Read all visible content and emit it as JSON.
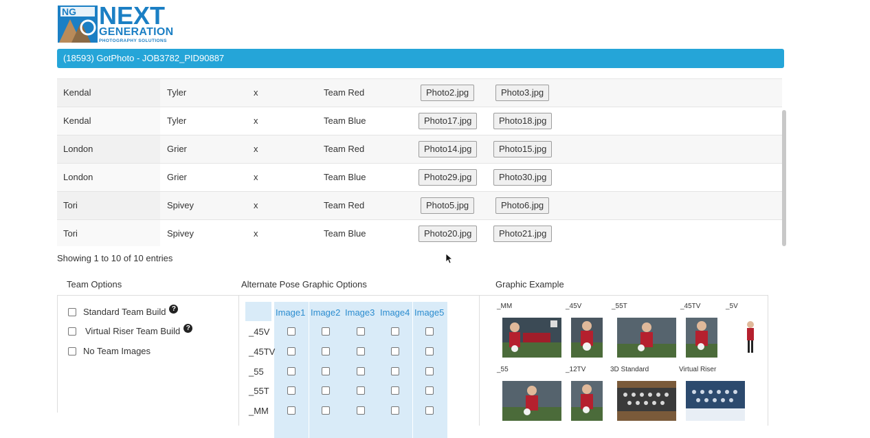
{
  "logo": {
    "line1": "NEXT",
    "line2": "GENERATION",
    "line3": "PHOTOGRAPHY SOLUTIONS",
    "color": "#1b7fc4"
  },
  "title_bar": {
    "text": "(18593) GotPhoto - JOB3782_PID90887",
    "color": "#25a5d8"
  },
  "table": {
    "rows": [
      {
        "first": "Kendal",
        "last": "Tyler",
        "x": "x",
        "team": "Team Red",
        "photo1": "Photo2.jpg",
        "photo2": "Photo3.jpg"
      },
      {
        "first": "Kendal",
        "last": "Tyler",
        "x": "x",
        "team": "Team Blue",
        "photo1": "Photo17.jpg",
        "photo2": "Photo18.jpg"
      },
      {
        "first": "London",
        "last": "Grier",
        "x": "x",
        "team": "Team Red",
        "photo1": "Photo14.jpg",
        "photo2": "Photo15.jpg"
      },
      {
        "first": "London",
        "last": "Grier",
        "x": "x",
        "team": "Team Blue",
        "photo1": "Photo29.jpg",
        "photo2": "Photo30.jpg"
      },
      {
        "first": "Tori",
        "last": "Spivey",
        "x": "x",
        "team": "Team Red",
        "photo1": "Photo5.jpg",
        "photo2": "Photo6.jpg"
      },
      {
        "first": "Tori",
        "last": "Spivey",
        "x": "x",
        "team": "Team Blue",
        "photo1": "Photo20.jpg",
        "photo2": "Photo21.jpg"
      }
    ],
    "showing": "Showing 1 to 10 of 10 entries"
  },
  "team_options": {
    "heading": "Team Options",
    "items": [
      "Standard Team Build",
      "Virtual Riser Team Build",
      "No Team Images"
    ],
    "help_glyph": "?"
  },
  "alt_pose": {
    "heading": "Alternate Pose Graphic Options",
    "columns": [
      "Image1",
      "Image2",
      "Image3",
      "Image4",
      "Image5"
    ],
    "rows": [
      "_45V",
      "_45TV",
      "_55",
      "_55T",
      "_MM"
    ],
    "header_color": "#2b8ccf",
    "highlight_color": "#d9ebf8"
  },
  "graphic_example": {
    "heading": "Graphic Example",
    "row1_labels": [
      "_MM",
      "_45V",
      "_55T",
      "_45TV",
      "_5V"
    ],
    "row2_labels": [
      "_55",
      "_12TV",
      "3D Standard",
      "Virtual Riser"
    ]
  }
}
